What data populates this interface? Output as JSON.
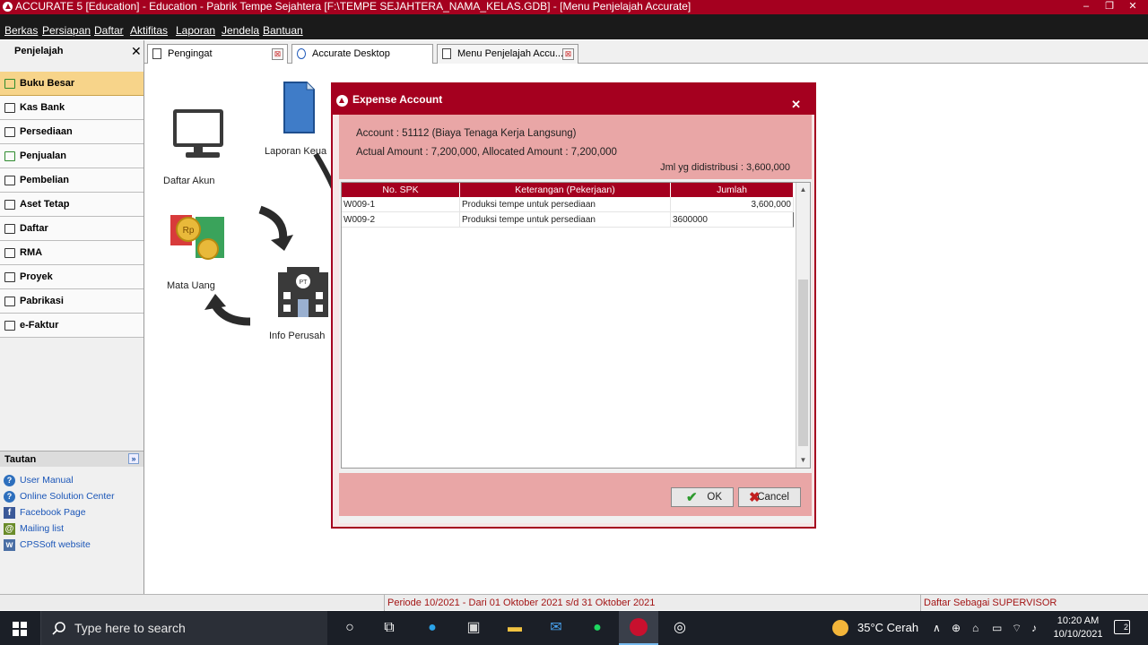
{
  "window": {
    "title": "ACCURATE 5 [Education] - Education - Pabrik Tempe Sejahtera  [F:\\TEMPE SEJAHTERA_NAMA_KELAS.GDB] - [Menu Penjelajah Accurate]",
    "minimize": "–",
    "restore": "❐",
    "close": "✕"
  },
  "menu": [
    "Berkas",
    "Persiapan",
    "Daftar",
    "Aktifitas",
    "Laporan",
    "Jendela",
    "Bantuan"
  ],
  "sidebar": {
    "title": "Penjelajah",
    "close": "✕",
    "items": [
      "Buku Besar",
      "Kas Bank",
      "Persediaan",
      "Penjualan",
      "Pembelian",
      "Aset Tetap",
      "Daftar",
      "RMA",
      "Proyek",
      "Pabrikasi",
      "e-Faktur"
    ],
    "tautan_title": "Tautan",
    "tautan_toggle": "»",
    "links": [
      "User Manual",
      "Online Solution Center",
      "Facebook Page",
      "Mailing list",
      "CPSSoft website"
    ]
  },
  "tabs": [
    {
      "label": "Pengingat",
      "close": "⊠"
    },
    {
      "label": "Accurate Desktop Welcome...",
      "close": ""
    },
    {
      "label": "Menu Penjelajah Accu...",
      "close": "⊠"
    }
  ],
  "explorer": {
    "labels": [
      "Daftar Akun",
      "Laporan Keua",
      "Mata Uang",
      "Info Perusah"
    ],
    "currency_badge": "Rp",
    "company_badge": "PT"
  },
  "dialog": {
    "title": "Expense Account",
    "close": "✕",
    "account_line": "Account : 51112 (Biaya Tenaga Kerja Langsung)",
    "amount_line": "Actual Amount : 7,200,000, Allocated Amount : 7,200,000",
    "distributed_line": "Jml yg didistribusi : 3,600,000",
    "columns": [
      "No. SPK",
      "Keterangan (Pekerjaan)",
      "Jumlah"
    ],
    "rows": [
      {
        "spk": "W009-1",
        "ket": "Produksi tempe untuk persediaan",
        "jumlah": "3,600,000"
      },
      {
        "spk": "W009-2",
        "ket": "Produksi tempe untuk persediaan",
        "jumlah": "3600000"
      }
    ],
    "scroll_up": "▲",
    "scroll_down": "▼",
    "ok_label": "OK",
    "cancel_label": "Cancel",
    "ok_icon": "✔",
    "cancel_icon": "✖"
  },
  "status": {
    "period": "Periode 10/2021 - Dari 01 Oktober 2021 s/d 31 Oktober 2021",
    "user": "Daftar Sebagai SUPERVISOR"
  },
  "taskbar": {
    "search_placeholder": "Type here to search",
    "weather": "35°C  Cerah",
    "time": "10:20 AM",
    "date": "10/10/2021",
    "notification_count": "2"
  }
}
